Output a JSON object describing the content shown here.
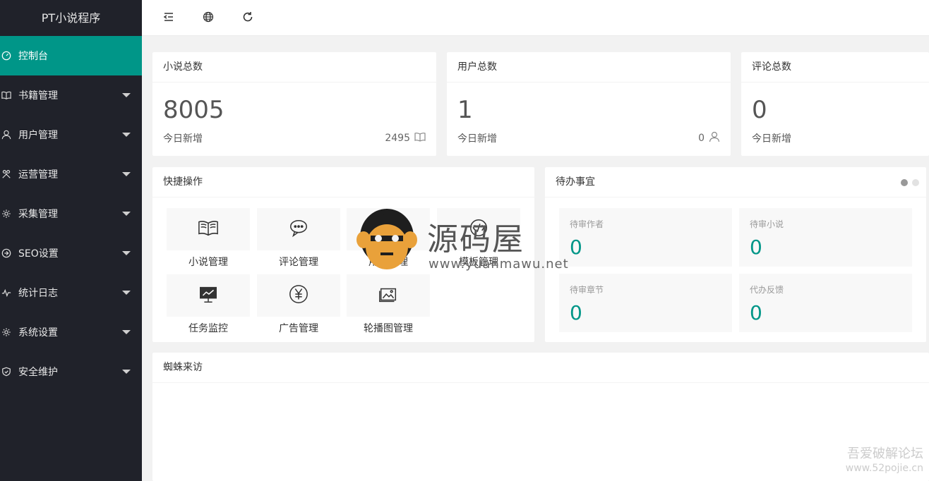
{
  "app": {
    "title": "PT小说程序"
  },
  "sidebar": {
    "items": [
      {
        "label": "控制台",
        "icon": "dashboard-icon",
        "active": true,
        "caret": false
      },
      {
        "label": "书籍管理",
        "icon": "book-icon",
        "active": false,
        "caret": true
      },
      {
        "label": "用户管理",
        "icon": "user-icon",
        "active": false,
        "caret": true
      },
      {
        "label": "运营管理",
        "icon": "tools-icon",
        "active": false,
        "caret": true
      },
      {
        "label": "采集管理",
        "icon": "gear-icon",
        "active": false,
        "caret": true
      },
      {
        "label": "SEO设置",
        "icon": "seo-icon",
        "active": false,
        "caret": true
      },
      {
        "label": "统计日志",
        "icon": "pulse-icon",
        "active": false,
        "caret": true
      },
      {
        "label": "系统设置",
        "icon": "gear-icon",
        "active": false,
        "caret": true
      },
      {
        "label": "安全维护",
        "icon": "shield-icon",
        "active": false,
        "caret": true
      }
    ]
  },
  "header": {
    "icons": [
      "menu-fold-icon",
      "globe-icon",
      "refresh-icon"
    ]
  },
  "stats": [
    {
      "title": "小说总数",
      "value": "8005",
      "sub_label": "今日新增",
      "today": "2495",
      "icon": "book-icon"
    },
    {
      "title": "用户总数",
      "value": "1",
      "sub_label": "今日新增",
      "today": "0",
      "icon": "user-icon"
    },
    {
      "title": "评论总数",
      "value": "0",
      "sub_label": "今日新增",
      "today": "",
      "icon": ""
    }
  ],
  "shortcuts": {
    "title": "快捷操作",
    "items": [
      {
        "label": "小说管理",
        "icon": "book-icon"
      },
      {
        "label": "评论管理",
        "icon": "comment-icon"
      },
      {
        "label": "用户管理",
        "icon": "user-icon"
      },
      {
        "label": "模板管理",
        "icon": "template-icon"
      },
      {
        "label": "任务监控",
        "icon": "monitor-icon"
      },
      {
        "label": "广告管理",
        "icon": "yen-icon"
      },
      {
        "label": "轮播图管理",
        "icon": "picture-icon"
      }
    ]
  },
  "todo": {
    "title": "待办事宜",
    "items": [
      {
        "label": "待审作者",
        "value": "0"
      },
      {
        "label": "待审小说",
        "value": "0"
      },
      {
        "label": "待审章节",
        "value": "0"
      },
      {
        "label": "代办反馈",
        "value": "0"
      }
    ],
    "pages": 2,
    "current_page": 1
  },
  "spider": {
    "title": "蜘蛛来访"
  },
  "watermark": {
    "brand": "源码屋",
    "url": "www.yuanmawu.net",
    "forum": "吾爱破解论坛",
    "forum_url": "www.52pojie.cn"
  },
  "colors": {
    "sidebar_bg": "#20222a",
    "accent": "#009688",
    "page_bg": "#f2f2f2"
  }
}
